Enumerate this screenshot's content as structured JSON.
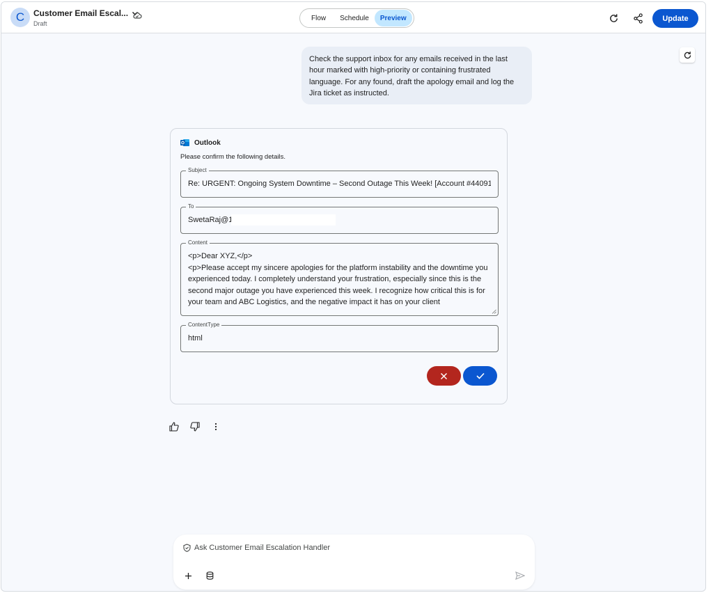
{
  "header": {
    "avatar_letter": "C",
    "app_title": "Customer Email Escal...",
    "status": "Draft",
    "tabs": [
      {
        "label": "Flow",
        "active": false
      },
      {
        "label": "Schedule",
        "active": false
      },
      {
        "label": "Preview",
        "active": true
      }
    ],
    "update_label": "Update"
  },
  "chat": {
    "user_message": "Check the support inbox for any emails received in the last hour marked with high-priority or containing frustrated language. For any found, draft the apology email and log the Jira ticket as instructed."
  },
  "tool_card": {
    "app_name": "Outlook",
    "description": "Please confirm the following details.",
    "fields": {
      "subject": {
        "label": "Subject",
        "value": "Re: URGENT: Ongoing System Downtime – Second Outage This Week! [Account #44091"
      },
      "to": {
        "label": "To",
        "value": "SwetaRaj@1"
      },
      "content": {
        "label": "Content",
        "value": "<p>Dear XYZ,</p>\n<p>Please accept my sincere apologies for the platform instability and the downtime you experienced today. I completely understand your frustration, especially since this is the second major outage you have experienced this week. I recognize how critical this is for your team and ABC Logistics, and the negative impact it has on your client"
      },
      "content_type": {
        "label": "ContentType",
        "value": "html"
      }
    }
  },
  "composer": {
    "placeholder": "Ask Customer Email Escalation Handler"
  },
  "colors": {
    "accent": "#0b57d0",
    "cancel": "#b3261e",
    "active_tab_bg": "#c2e7ff",
    "user_bubble": "#e9eef6"
  },
  "icons": {
    "cloud": "cloud-icon",
    "refresh": "refresh-icon",
    "share": "share-icon",
    "outlook": "outlook-icon",
    "thumbs_up": "thumbs-up-icon",
    "thumbs_down": "thumbs-down-icon",
    "more": "more-vert-icon",
    "shield": "shield-icon",
    "add": "add-icon",
    "database": "database-icon",
    "send": "send-icon"
  }
}
